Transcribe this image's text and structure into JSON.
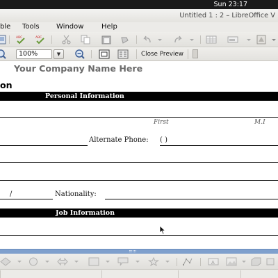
{
  "system": {
    "clock": "Sun 23:17"
  },
  "window": {
    "title": "Untitled 1 : 2 – LibreOffice V"
  },
  "menu": {
    "items": [
      "ble",
      "Tools",
      "Window",
      "Help"
    ]
  },
  "toolbar": {
    "zoom": "100%",
    "close_preview": "Close Preview",
    "icons": [
      "page-preview-icon",
      "spellcheck-icon",
      "autospellcheck-icon",
      "cut-icon",
      "copy-icon",
      "paste-icon",
      "clone-formatting-icon",
      "undo-icon",
      "redo-icon",
      "table-icon",
      "chart-icon",
      "zoom-out-icon",
      "full-screen-icon",
      "two-pages-icon"
    ]
  },
  "document": {
    "company": "Your Company Name Here",
    "heading": "on",
    "sections": [
      "Personal Information",
      "Job Information"
    ],
    "hints": {
      "first": "First",
      "mi": "M.I"
    },
    "labels": {
      "alternate_phone": "Alternate Phone:",
      "phone_placeholder": "(     )",
      "nationality": "Nationality:",
      "date_slash": "/"
    }
  },
  "drawing_toolbar": {
    "icons": [
      "basic-shapes-icon",
      "symbol-shapes-icon",
      "block-arrows-icon",
      "flowchart-icon",
      "callouts-icon",
      "stars-icon",
      "points-icon",
      "fontwork-icon",
      "from-file-icon",
      "extrusion-icon"
    ]
  }
}
